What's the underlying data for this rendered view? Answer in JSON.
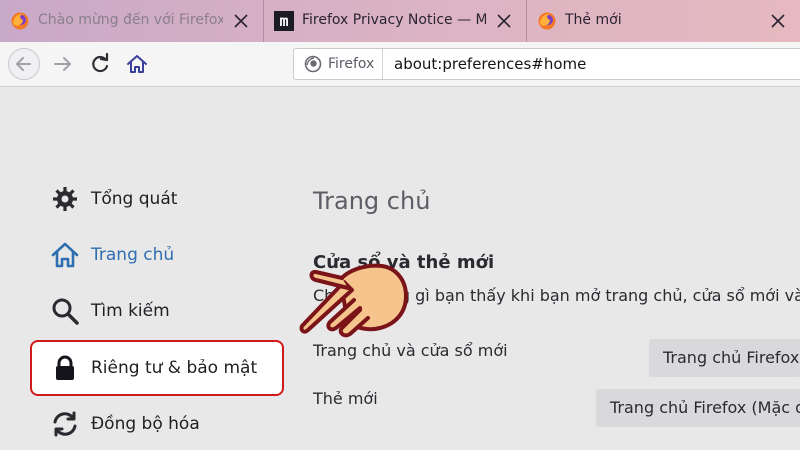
{
  "tabs": [
    {
      "title": "Chào mừng đến với Firefox",
      "icon": "firefox-icon"
    },
    {
      "title": "Firefox Privacy Notice — Mozilla",
      "icon": "mozilla-m-icon"
    },
    {
      "title": "Thẻ mới",
      "icon": "firefox-icon"
    }
  ],
  "navbar": {
    "identity_label": "Firefox",
    "url": "about:preferences#home"
  },
  "sidebar": {
    "items": [
      {
        "label": "Tổng quát",
        "icon": "gear-icon"
      },
      {
        "label": "Trang chủ",
        "icon": "home-icon",
        "active": true
      },
      {
        "label": "Tìm kiếm",
        "icon": "search-icon"
      },
      {
        "label": "Riêng tư & bảo mật",
        "icon": "lock-icon",
        "highlighted": true
      },
      {
        "label": "Đồng bộ hóa",
        "icon": "sync-icon"
      }
    ]
  },
  "main": {
    "heading": "Trang chủ",
    "section_title": "Cửa sổ và thẻ mới",
    "section_desc": "Chọn những gì bạn thấy khi bạn mở trang chủ, cửa sổ mới và c",
    "rows": [
      {
        "label": "Trang chủ và cửa sổ mới",
        "value": "Trang chủ Firefox (Mặc định)"
      },
      {
        "label": "Thẻ mới",
        "value": "Trang chủ Firefox (Mặc định)"
      }
    ]
  },
  "colors": {
    "active_blue": "#2f6eb0",
    "highlight_red": "#d0191b",
    "hand_fill": "#f6c58e",
    "hand_outline": "#7a1418"
  }
}
